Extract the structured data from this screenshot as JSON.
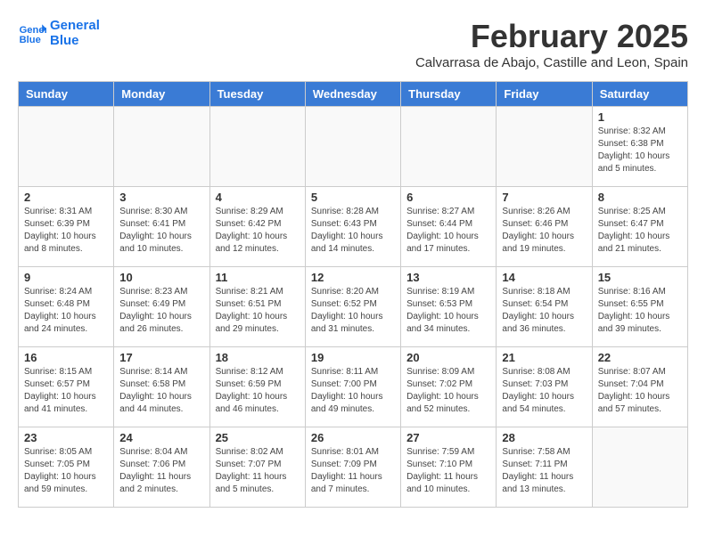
{
  "header": {
    "logo_line1": "General",
    "logo_line2": "Blue",
    "month_year": "February 2025",
    "location": "Calvarrasa de Abajo, Castille and Leon, Spain"
  },
  "days_of_week": [
    "Sunday",
    "Monday",
    "Tuesday",
    "Wednesday",
    "Thursday",
    "Friday",
    "Saturday"
  ],
  "weeks": [
    [
      {
        "day": "",
        "info": ""
      },
      {
        "day": "",
        "info": ""
      },
      {
        "day": "",
        "info": ""
      },
      {
        "day": "",
        "info": ""
      },
      {
        "day": "",
        "info": ""
      },
      {
        "day": "",
        "info": ""
      },
      {
        "day": "1",
        "info": "Sunrise: 8:32 AM\nSunset: 6:38 PM\nDaylight: 10 hours\nand 5 minutes."
      }
    ],
    [
      {
        "day": "2",
        "info": "Sunrise: 8:31 AM\nSunset: 6:39 PM\nDaylight: 10 hours\nand 8 minutes."
      },
      {
        "day": "3",
        "info": "Sunrise: 8:30 AM\nSunset: 6:41 PM\nDaylight: 10 hours\nand 10 minutes."
      },
      {
        "day": "4",
        "info": "Sunrise: 8:29 AM\nSunset: 6:42 PM\nDaylight: 10 hours\nand 12 minutes."
      },
      {
        "day": "5",
        "info": "Sunrise: 8:28 AM\nSunset: 6:43 PM\nDaylight: 10 hours\nand 14 minutes."
      },
      {
        "day": "6",
        "info": "Sunrise: 8:27 AM\nSunset: 6:44 PM\nDaylight: 10 hours\nand 17 minutes."
      },
      {
        "day": "7",
        "info": "Sunrise: 8:26 AM\nSunset: 6:46 PM\nDaylight: 10 hours\nand 19 minutes."
      },
      {
        "day": "8",
        "info": "Sunrise: 8:25 AM\nSunset: 6:47 PM\nDaylight: 10 hours\nand 21 minutes."
      }
    ],
    [
      {
        "day": "9",
        "info": "Sunrise: 8:24 AM\nSunset: 6:48 PM\nDaylight: 10 hours\nand 24 minutes."
      },
      {
        "day": "10",
        "info": "Sunrise: 8:23 AM\nSunset: 6:49 PM\nDaylight: 10 hours\nand 26 minutes."
      },
      {
        "day": "11",
        "info": "Sunrise: 8:21 AM\nSunset: 6:51 PM\nDaylight: 10 hours\nand 29 minutes."
      },
      {
        "day": "12",
        "info": "Sunrise: 8:20 AM\nSunset: 6:52 PM\nDaylight: 10 hours\nand 31 minutes."
      },
      {
        "day": "13",
        "info": "Sunrise: 8:19 AM\nSunset: 6:53 PM\nDaylight: 10 hours\nand 34 minutes."
      },
      {
        "day": "14",
        "info": "Sunrise: 8:18 AM\nSunset: 6:54 PM\nDaylight: 10 hours\nand 36 minutes."
      },
      {
        "day": "15",
        "info": "Sunrise: 8:16 AM\nSunset: 6:55 PM\nDaylight: 10 hours\nand 39 minutes."
      }
    ],
    [
      {
        "day": "16",
        "info": "Sunrise: 8:15 AM\nSunset: 6:57 PM\nDaylight: 10 hours\nand 41 minutes."
      },
      {
        "day": "17",
        "info": "Sunrise: 8:14 AM\nSunset: 6:58 PM\nDaylight: 10 hours\nand 44 minutes."
      },
      {
        "day": "18",
        "info": "Sunrise: 8:12 AM\nSunset: 6:59 PM\nDaylight: 10 hours\nand 46 minutes."
      },
      {
        "day": "19",
        "info": "Sunrise: 8:11 AM\nSunset: 7:00 PM\nDaylight: 10 hours\nand 49 minutes."
      },
      {
        "day": "20",
        "info": "Sunrise: 8:09 AM\nSunset: 7:02 PM\nDaylight: 10 hours\nand 52 minutes."
      },
      {
        "day": "21",
        "info": "Sunrise: 8:08 AM\nSunset: 7:03 PM\nDaylight: 10 hours\nand 54 minutes."
      },
      {
        "day": "22",
        "info": "Sunrise: 8:07 AM\nSunset: 7:04 PM\nDaylight: 10 hours\nand 57 minutes."
      }
    ],
    [
      {
        "day": "23",
        "info": "Sunrise: 8:05 AM\nSunset: 7:05 PM\nDaylight: 10 hours\nand 59 minutes."
      },
      {
        "day": "24",
        "info": "Sunrise: 8:04 AM\nSunset: 7:06 PM\nDaylight: 11 hours\nand 2 minutes."
      },
      {
        "day": "25",
        "info": "Sunrise: 8:02 AM\nSunset: 7:07 PM\nDaylight: 11 hours\nand 5 minutes."
      },
      {
        "day": "26",
        "info": "Sunrise: 8:01 AM\nSunset: 7:09 PM\nDaylight: 11 hours\nand 7 minutes."
      },
      {
        "day": "27",
        "info": "Sunrise: 7:59 AM\nSunset: 7:10 PM\nDaylight: 11 hours\nand 10 minutes."
      },
      {
        "day": "28",
        "info": "Sunrise: 7:58 AM\nSunset: 7:11 PM\nDaylight: 11 hours\nand 13 minutes."
      },
      {
        "day": "",
        "info": ""
      }
    ]
  ]
}
